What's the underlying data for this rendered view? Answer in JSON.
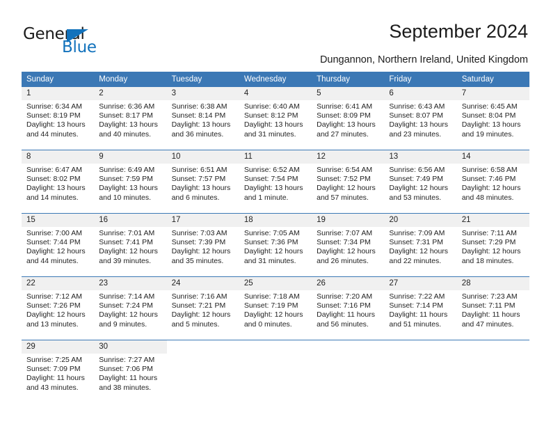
{
  "brand": {
    "name_part1": "General",
    "name_part2": "Blue"
  },
  "header": {
    "title": "September 2024",
    "location": "Dungannon, Northern Ireland, United Kingdom"
  },
  "calendar": {
    "weekday_headers": [
      "Sunday",
      "Monday",
      "Tuesday",
      "Wednesday",
      "Thursday",
      "Friday",
      "Saturday"
    ],
    "accent_color": "#3b78b5",
    "daynum_background": "#f0f0f0",
    "weeks": [
      [
        {
          "day": "1",
          "sunrise": "Sunrise: 6:34 AM",
          "sunset": "Sunset: 8:19 PM",
          "daylight_line1": "Daylight: 13 hours",
          "daylight_line2": "and 44 minutes."
        },
        {
          "day": "2",
          "sunrise": "Sunrise: 6:36 AM",
          "sunset": "Sunset: 8:17 PM",
          "daylight_line1": "Daylight: 13 hours",
          "daylight_line2": "and 40 minutes."
        },
        {
          "day": "3",
          "sunrise": "Sunrise: 6:38 AM",
          "sunset": "Sunset: 8:14 PM",
          "daylight_line1": "Daylight: 13 hours",
          "daylight_line2": "and 36 minutes."
        },
        {
          "day": "4",
          "sunrise": "Sunrise: 6:40 AM",
          "sunset": "Sunset: 8:12 PM",
          "daylight_line1": "Daylight: 13 hours",
          "daylight_line2": "and 31 minutes."
        },
        {
          "day": "5",
          "sunrise": "Sunrise: 6:41 AM",
          "sunset": "Sunset: 8:09 PM",
          "daylight_line1": "Daylight: 13 hours",
          "daylight_line2": "and 27 minutes."
        },
        {
          "day": "6",
          "sunrise": "Sunrise: 6:43 AM",
          "sunset": "Sunset: 8:07 PM",
          "daylight_line1": "Daylight: 13 hours",
          "daylight_line2": "and 23 minutes."
        },
        {
          "day": "7",
          "sunrise": "Sunrise: 6:45 AM",
          "sunset": "Sunset: 8:04 PM",
          "daylight_line1": "Daylight: 13 hours",
          "daylight_line2": "and 19 minutes."
        }
      ],
      [
        {
          "day": "8",
          "sunrise": "Sunrise: 6:47 AM",
          "sunset": "Sunset: 8:02 PM",
          "daylight_line1": "Daylight: 13 hours",
          "daylight_line2": "and 14 minutes."
        },
        {
          "day": "9",
          "sunrise": "Sunrise: 6:49 AM",
          "sunset": "Sunset: 7:59 PM",
          "daylight_line1": "Daylight: 13 hours",
          "daylight_line2": "and 10 minutes."
        },
        {
          "day": "10",
          "sunrise": "Sunrise: 6:51 AM",
          "sunset": "Sunset: 7:57 PM",
          "daylight_line1": "Daylight: 13 hours",
          "daylight_line2": "and 6 minutes."
        },
        {
          "day": "11",
          "sunrise": "Sunrise: 6:52 AM",
          "sunset": "Sunset: 7:54 PM",
          "daylight_line1": "Daylight: 13 hours",
          "daylight_line2": "and 1 minute."
        },
        {
          "day": "12",
          "sunrise": "Sunrise: 6:54 AM",
          "sunset": "Sunset: 7:52 PM",
          "daylight_line1": "Daylight: 12 hours",
          "daylight_line2": "and 57 minutes."
        },
        {
          "day": "13",
          "sunrise": "Sunrise: 6:56 AM",
          "sunset": "Sunset: 7:49 PM",
          "daylight_line1": "Daylight: 12 hours",
          "daylight_line2": "and 53 minutes."
        },
        {
          "day": "14",
          "sunrise": "Sunrise: 6:58 AM",
          "sunset": "Sunset: 7:46 PM",
          "daylight_line1": "Daylight: 12 hours",
          "daylight_line2": "and 48 minutes."
        }
      ],
      [
        {
          "day": "15",
          "sunrise": "Sunrise: 7:00 AM",
          "sunset": "Sunset: 7:44 PM",
          "daylight_line1": "Daylight: 12 hours",
          "daylight_line2": "and 44 minutes."
        },
        {
          "day": "16",
          "sunrise": "Sunrise: 7:01 AM",
          "sunset": "Sunset: 7:41 PM",
          "daylight_line1": "Daylight: 12 hours",
          "daylight_line2": "and 39 minutes."
        },
        {
          "day": "17",
          "sunrise": "Sunrise: 7:03 AM",
          "sunset": "Sunset: 7:39 PM",
          "daylight_line1": "Daylight: 12 hours",
          "daylight_line2": "and 35 minutes."
        },
        {
          "day": "18",
          "sunrise": "Sunrise: 7:05 AM",
          "sunset": "Sunset: 7:36 PM",
          "daylight_line1": "Daylight: 12 hours",
          "daylight_line2": "and 31 minutes."
        },
        {
          "day": "19",
          "sunrise": "Sunrise: 7:07 AM",
          "sunset": "Sunset: 7:34 PM",
          "daylight_line1": "Daylight: 12 hours",
          "daylight_line2": "and 26 minutes."
        },
        {
          "day": "20",
          "sunrise": "Sunrise: 7:09 AM",
          "sunset": "Sunset: 7:31 PM",
          "daylight_line1": "Daylight: 12 hours",
          "daylight_line2": "and 22 minutes."
        },
        {
          "day": "21",
          "sunrise": "Sunrise: 7:11 AM",
          "sunset": "Sunset: 7:29 PM",
          "daylight_line1": "Daylight: 12 hours",
          "daylight_line2": "and 18 minutes."
        }
      ],
      [
        {
          "day": "22",
          "sunrise": "Sunrise: 7:12 AM",
          "sunset": "Sunset: 7:26 PM",
          "daylight_line1": "Daylight: 12 hours",
          "daylight_line2": "and 13 minutes."
        },
        {
          "day": "23",
          "sunrise": "Sunrise: 7:14 AM",
          "sunset": "Sunset: 7:24 PM",
          "daylight_line1": "Daylight: 12 hours",
          "daylight_line2": "and 9 minutes."
        },
        {
          "day": "24",
          "sunrise": "Sunrise: 7:16 AM",
          "sunset": "Sunset: 7:21 PM",
          "daylight_line1": "Daylight: 12 hours",
          "daylight_line2": "and 5 minutes."
        },
        {
          "day": "25",
          "sunrise": "Sunrise: 7:18 AM",
          "sunset": "Sunset: 7:19 PM",
          "daylight_line1": "Daylight: 12 hours",
          "daylight_line2": "and 0 minutes."
        },
        {
          "day": "26",
          "sunrise": "Sunrise: 7:20 AM",
          "sunset": "Sunset: 7:16 PM",
          "daylight_line1": "Daylight: 11 hours",
          "daylight_line2": "and 56 minutes."
        },
        {
          "day": "27",
          "sunrise": "Sunrise: 7:22 AM",
          "sunset": "Sunset: 7:14 PM",
          "daylight_line1": "Daylight: 11 hours",
          "daylight_line2": "and 51 minutes."
        },
        {
          "day": "28",
          "sunrise": "Sunrise: 7:23 AM",
          "sunset": "Sunset: 7:11 PM",
          "daylight_line1": "Daylight: 11 hours",
          "daylight_line2": "and 47 minutes."
        }
      ],
      [
        {
          "day": "29",
          "sunrise": "Sunrise: 7:25 AM",
          "sunset": "Sunset: 7:09 PM",
          "daylight_line1": "Daylight: 11 hours",
          "daylight_line2": "and 43 minutes."
        },
        {
          "day": "30",
          "sunrise": "Sunrise: 7:27 AM",
          "sunset": "Sunset: 7:06 PM",
          "daylight_line1": "Daylight: 11 hours",
          "daylight_line2": "and 38 minutes."
        },
        null,
        null,
        null,
        null,
        null
      ]
    ]
  }
}
